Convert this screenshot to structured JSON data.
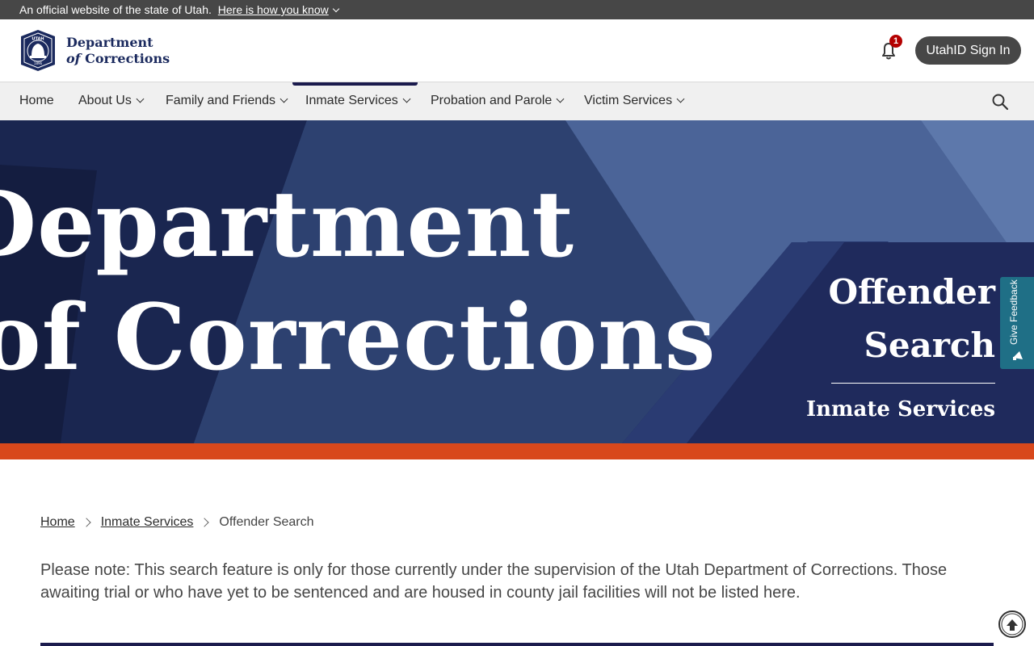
{
  "gov_banner": {
    "text": "An official website of the state of Utah.",
    "link": "Here is how you know"
  },
  "header": {
    "logo_line1": "Department",
    "logo_line2_prefix": "of",
    "logo_line2": "Corrections",
    "seal_text": "UTAH",
    "seal_year": "1896",
    "notification_count": "1",
    "signin_label": "UtahID Sign In"
  },
  "nav": {
    "items": [
      {
        "label": "Home"
      },
      {
        "label": "About Us"
      },
      {
        "label": "Family and Friends"
      },
      {
        "label": "Inmate Services"
      },
      {
        "label": "Probation and Parole"
      },
      {
        "label": "Victim Services"
      }
    ],
    "active": "Inmate Services"
  },
  "hero": {
    "bg_line1": "Department",
    "bg_line2": "of Corrections",
    "title": "Offender Search",
    "subtitle": "Inmate Services"
  },
  "feedback": {
    "label": "Give Feedback"
  },
  "breadcrumb": {
    "items": [
      "Home",
      "Inmate Services"
    ],
    "current": "Offender Search"
  },
  "notice": "Please note: This search feature is only for those currently under the supervision of the Utah Department of Corrections. Those awaiting trial or who have yet to be sentenced and are housed in county jail facilities will not be listed here.",
  "colors": {
    "banner_bg": "#474747",
    "nav_bg": "#f0f0f0",
    "brand_navy": "#1b1b4d",
    "hero_blue": "#344a7a",
    "accent_orange": "#d8481c",
    "feedback_teal": "#1f6f86",
    "badge_red": "#b40000"
  },
  "icons": {
    "bell": "bell-icon",
    "search": "search-icon",
    "back_to_top": "arrow-up-circle-icon",
    "feedback": "megaphone-icon",
    "chevron": "chevron-down-icon"
  }
}
